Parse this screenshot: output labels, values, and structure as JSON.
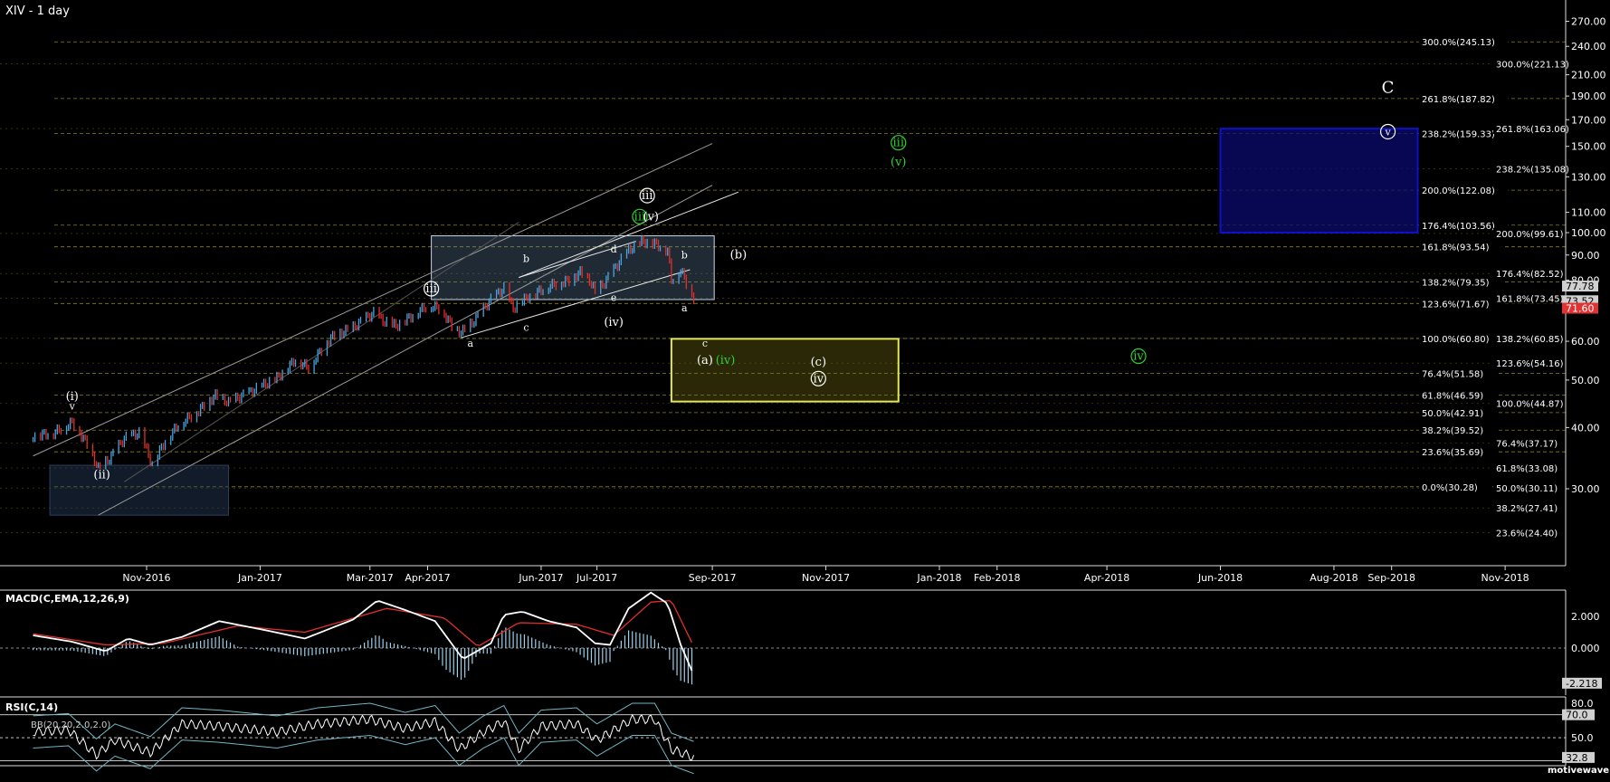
{
  "header": {
    "symbol_title": "XIV - 1 day",
    "watermark": "motivewave.com"
  },
  "colors": {
    "bg": "#000000",
    "bar_up": "#4aa3df",
    "bar_down": "#e0302c",
    "grid": "#b7b01e",
    "green_label": "#2fd22f",
    "blue_box": "#1010c8",
    "yellow_box": "#e5e65a",
    "price_tag": "#cfcfcf"
  },
  "chart_data": [
    {
      "type": "line",
      "name": "price",
      "title": "XIV - 1 day",
      "y_scale": "log",
      "y_axis_ticks": [
        30,
        40,
        50,
        60,
        80,
        90,
        100,
        110,
        130,
        150,
        170,
        190,
        210,
        240,
        270
      ],
      "y_axis_tick_labels": [
        "30.00",
        "40.00",
        "50.00",
        "60.00",
        "80.00",
        "90.00",
        "100.00",
        "110.00",
        "130.00",
        "150.00",
        "170.00",
        "190.00",
        "210.00",
        "240.00",
        "270.00"
      ],
      "x_axis_ticks": [
        "Nov-2016",
        "Jan-2017",
        "Mar-2017",
        "Apr-2017",
        "Jun-2017",
        "Jul-2017",
        "Sep-2017",
        "Nov-2017",
        "Jan-2018",
        "Feb-2018",
        "Apr-2018",
        "Jun-2018",
        "Aug-2018",
        "Sep-2018",
        "Nov-2018"
      ],
      "x_axis_tick_dates": [
        "2016-11-01",
        "2017-01-01",
        "2017-03-01",
        "2017-04-01",
        "2017-06-01",
        "2017-07-01",
        "2017-09-01",
        "2017-11-01",
        "2018-01-01",
        "2018-02-01",
        "2018-04-01",
        "2018-06-01",
        "2018-08-01",
        "2018-09-01",
        "2018-11-01"
      ],
      "price_path": [
        [
          "2016-09-01",
          38.5
        ],
        [
          "2016-09-12",
          39
        ],
        [
          "2016-09-22",
          41
        ],
        [
          "2016-09-30",
          37
        ],
        [
          "2016-10-06",
          33
        ],
        [
          "2016-10-12",
          34.5
        ],
        [
          "2016-10-20",
          38
        ],
        [
          "2016-10-28",
          39
        ],
        [
          "2016-11-01",
          36
        ],
        [
          "2016-11-04",
          33.5
        ],
        [
          "2016-11-10",
          37
        ],
        [
          "2016-11-18",
          40.5
        ],
        [
          "2016-11-28",
          43
        ],
        [
          "2016-12-08",
          46.5
        ],
        [
          "2016-12-15",
          45
        ],
        [
          "2016-12-28",
          47.5
        ],
        [
          "2017-01-10",
          50.5
        ],
        [
          "2017-01-20",
          55
        ],
        [
          "2017-01-27",
          53
        ],
        [
          "2017-02-08",
          61
        ],
        [
          "2017-02-20",
          64
        ],
        [
          "2017-02-27",
          67
        ],
        [
          "2017-03-03",
          68.5
        ],
        [
          "2017-03-08",
          66
        ],
        [
          "2017-03-15",
          64.5
        ],
        [
          "2017-03-22",
          67
        ],
        [
          "2017-04-01",
          71
        ],
        [
          "2017-04-08",
          70
        ],
        [
          "2017-04-14",
          64.5
        ],
        [
          "2017-04-19",
          62.5
        ],
        [
          "2017-04-26",
          66
        ],
        [
          "2017-05-05",
          73
        ],
        [
          "2017-05-12",
          77
        ],
        [
          "2017-05-17",
          70
        ],
        [
          "2017-05-25",
          74
        ],
        [
          "2017-06-06",
          78
        ],
        [
          "2017-06-16",
          80
        ],
        [
          "2017-06-22",
          83
        ],
        [
          "2017-06-27",
          80
        ],
        [
          "2017-06-30",
          75.5
        ],
        [
          "2017-07-05",
          79
        ],
        [
          "2017-07-12",
          86
        ],
        [
          "2017-07-18",
          92
        ],
        [
          "2017-07-25",
          96
        ],
        [
          "2017-08-01",
          95
        ],
        [
          "2017-08-08",
          92
        ],
        [
          "2017-08-10",
          80
        ],
        [
          "2017-08-15",
          84
        ],
        [
          "2017-08-18",
          79
        ],
        [
          "2017-08-22",
          73.52
        ]
      ],
      "current_price_tags": [
        "77.78",
        "73.52",
        "71.60"
      ],
      "fib_levels_left": [
        "300.0%(245.13)",
        "261.8%(187.82)",
        "238.2%(159.33)",
        "200.0%(122.08)",
        "176.4%(103.56)",
        "161.8%(93.54)",
        "138.2%(79.35)",
        "123.6%(71.67)",
        "100.0%(60.80)",
        "76.4%(51.58)",
        "61.8%(46.59)",
        "50.0%(42.91)",
        "38.2%(39.52)",
        "23.6%(35.69)",
        "0.0%(30.28)"
      ],
      "fib_levels_left_values": [
        245.13,
        187.82,
        159.33,
        122.08,
        103.56,
        93.54,
        79.35,
        71.67,
        60.8,
        51.58,
        46.59,
        42.91,
        39.52,
        35.69,
        30.28
      ],
      "fib_levels_right": [
        "300.0%(221.13)",
        "261.8%(163.06)",
        "238.2%(135.08)",
        "200.0%(99.61)",
        "176.4%(82.52)",
        "161.8%(73.45)",
        "138.2%(60.85)",
        "123.6%(54.16)",
        "100.0%(44.87)",
        "76.4%(37.17)",
        "61.8%(33.08)",
        "50.0%(30.11)",
        "38.2%(27.41)",
        "23.6%(24.40)"
      ],
      "fib_levels_right_values": [
        221.13,
        163.06,
        135.08,
        99.61,
        82.52,
        73.45,
        60.85,
        54.16,
        44.87,
        37.17,
        33.08,
        30.11,
        27.41,
        24.4
      ],
      "wave_labels": [
        {
          "text": "(i)",
          "date": "2016-09-22",
          "price": 45.5,
          "color": "white",
          "circled": false
        },
        {
          "text": "v",
          "date": "2016-09-22",
          "price": 43.5,
          "color": "white",
          "circled": false
        },
        {
          "text": "(ii)",
          "date": "2016-10-08",
          "price": 31.5,
          "color": "white",
          "circled": false
        },
        {
          "text": "iii",
          "date": "2017-04-03",
          "price": 75.5,
          "color": "white",
          "circled": true
        },
        {
          "text": "a",
          "date": "2017-04-24",
          "price": 58.5,
          "color": "white",
          "circled": false
        },
        {
          "text": "b",
          "date": "2017-05-24",
          "price": 87,
          "color": "white",
          "circled": false
        },
        {
          "text": "c",
          "date": "2017-05-24",
          "price": 63,
          "color": "white",
          "circled": false
        },
        {
          "text": "d",
          "date": "2017-07-10",
          "price": 91,
          "color": "white",
          "circled": false
        },
        {
          "text": "e",
          "date": "2017-07-10",
          "price": 72.5,
          "color": "white",
          "circled": false
        },
        {
          "text": "(iv)",
          "date": "2017-07-10",
          "price": 64.5,
          "color": "white",
          "circled": false
        },
        {
          "text": "iii",
          "date": "2017-07-28",
          "price": 117,
          "color": "white",
          "circled": true
        },
        {
          "text": "iii",
          "date": "2017-07-24",
          "price": 106,
          "color": "green",
          "circled": true
        },
        {
          "text": "(v)",
          "date": "2017-07-30",
          "price": 106,
          "color": "white",
          "circled": false
        },
        {
          "text": "b",
          "date": "2017-08-17",
          "price": 88.5,
          "color": "white",
          "circled": false
        },
        {
          "text": "a",
          "date": "2017-08-17",
          "price": 69,
          "color": "white",
          "circled": false
        },
        {
          "text": "(b)",
          "date": "2017-09-15",
          "price": 88.5,
          "color": "white",
          "circled": false
        },
        {
          "text": "c",
          "date": "2017-08-28",
          "price": 58.5,
          "color": "white",
          "circled": false
        },
        {
          "text": "(a)",
          "date": "2017-08-28",
          "price": 54,
          "color": "white",
          "circled": false
        },
        {
          "text": "(iv)",
          "date": "2017-09-08",
          "price": 54,
          "color": "green",
          "circled": false
        },
        {
          "text": "(c)",
          "date": "2017-10-28",
          "price": 53.5,
          "color": "white",
          "circled": false
        },
        {
          "text": "iv",
          "date": "2017-10-28",
          "price": 49.5,
          "color": "white",
          "circled": true
        },
        {
          "text": "iii",
          "date": "2017-12-10",
          "price": 150,
          "color": "green",
          "circled": true
        },
        {
          "text": "(v)",
          "date": "2017-12-10",
          "price": 137,
          "color": "green",
          "circled": false
        },
        {
          "text": "iv",
          "date": "2018-04-18",
          "price": 55,
          "color": "green",
          "circled": true
        },
        {
          "text": "C",
          "date": "2018-08-30",
          "price": 193,
          "color": "white",
          "circled": false
        },
        {
          "text": "v",
          "date": "2018-08-30",
          "price": 158,
          "color": "white",
          "circled": true
        }
      ]
    },
    {
      "type": "line",
      "name": "macd_panel",
      "title": "MACD(C,EMA,12,26,9)",
      "y_axis_tick_labels": [
        "2.000",
        "0.000"
      ],
      "y_axis_ticks": [
        2.0,
        0.0
      ],
      "last_value": "-2.218",
      "macd_path": [
        [
          "2016-09-01",
          0.8
        ],
        [
          "2016-09-22",
          0.4
        ],
        [
          "2016-10-10",
          -0.2
        ],
        [
          "2016-10-22",
          0.6
        ],
        [
          "2016-11-03",
          0.2
        ],
        [
          "2016-11-20",
          0.7
        ],
        [
          "2016-12-10",
          1.7
        ],
        [
          "2017-01-05",
          1.1
        ],
        [
          "2017-01-25",
          0.6
        ],
        [
          "2017-02-20",
          1.8
        ],
        [
          "2017-03-05",
          3.0
        ],
        [
          "2017-03-20",
          2.4
        ],
        [
          "2017-04-05",
          1.7
        ],
        [
          "2017-04-20",
          -0.7
        ],
        [
          "2017-05-05",
          0.3
        ],
        [
          "2017-05-12",
          2.1
        ],
        [
          "2017-05-22",
          2.3
        ],
        [
          "2017-06-05",
          1.7
        ],
        [
          "2017-06-20",
          1.3
        ],
        [
          "2017-06-30",
          0.3
        ],
        [
          "2017-07-08",
          0.2
        ],
        [
          "2017-07-18",
          2.5
        ],
        [
          "2017-07-30",
          3.5
        ],
        [
          "2017-08-08",
          2.8
        ],
        [
          "2017-08-15",
          0.2
        ],
        [
          "2017-08-22",
          -1.7
        ]
      ],
      "signal_path": [
        [
          "2016-09-01",
          0.9
        ],
        [
          "2016-10-10",
          0.2
        ],
        [
          "2016-11-10",
          0.3
        ],
        [
          "2016-12-20",
          1.4
        ],
        [
          "2017-01-25",
          1.0
        ],
        [
          "2017-03-10",
          2.5
        ],
        [
          "2017-04-10",
          1.9
        ],
        [
          "2017-04-28",
          0.1
        ],
        [
          "2017-05-20",
          1.6
        ],
        [
          "2017-06-20",
          1.5
        ],
        [
          "2017-07-10",
          0.8
        ],
        [
          "2017-07-30",
          2.9
        ],
        [
          "2017-08-10",
          3.0
        ],
        [
          "2017-08-22",
          0.1
        ]
      ]
    },
    {
      "type": "line",
      "name": "rsi_panel",
      "title": "RSI(C,14)",
      "subtitle": "BB(20,20,2.0,2.0)",
      "y_axis_tick_labels": [
        "80.0",
        "70.0",
        "50.0",
        "32.8"
      ],
      "y_axis_ticks": [
        80,
        70,
        50,
        32.8
      ],
      "bands": [
        70,
        50,
        30
      ],
      "rsi_path": [
        [
          "2016-09-01",
          55
        ],
        [
          "2016-09-20",
          57
        ],
        [
          "2016-10-05",
          35
        ],
        [
          "2016-10-15",
          48
        ],
        [
          "2016-11-03",
          37
        ],
        [
          "2016-11-20",
          62
        ],
        [
          "2016-12-10",
          60
        ],
        [
          "2017-01-10",
          55
        ],
        [
          "2017-02-01",
          62
        ],
        [
          "2017-03-01",
          66
        ],
        [
          "2017-03-20",
          58
        ],
        [
          "2017-04-05",
          64
        ],
        [
          "2017-04-18",
          40
        ],
        [
          "2017-05-01",
          55
        ],
        [
          "2017-05-12",
          64
        ],
        [
          "2017-05-20",
          40
        ],
        [
          "2017-06-01",
          60
        ],
        [
          "2017-06-20",
          62
        ],
        [
          "2017-07-01",
          48
        ],
        [
          "2017-07-20",
          66
        ],
        [
          "2017-08-01",
          66
        ],
        [
          "2017-08-10",
          40
        ],
        [
          "2017-08-22",
          32.8
        ]
      ]
    }
  ]
}
